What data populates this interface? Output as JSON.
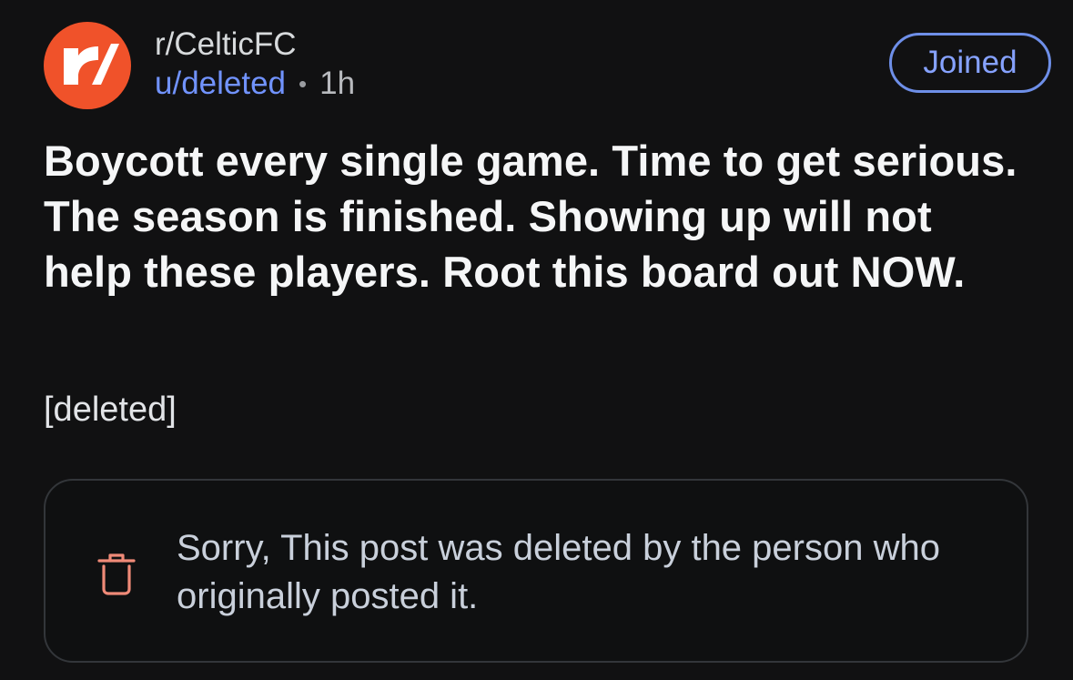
{
  "post": {
    "subreddit": "r/CelticFC",
    "author": "u/deleted",
    "separator": "•",
    "time": "1h",
    "join_button_label": "Joined",
    "title": "Boycott every single game. Time to get serious. The season is finished. Showing up will not help these players. Root this board out NOW.",
    "body": "[deleted]"
  },
  "notice": {
    "icon": "trash-icon",
    "text": "Sorry, This post was deleted by the person who originally posted it."
  },
  "colors": {
    "background": "#111112",
    "avatar": "#f0522a",
    "author": "#7193ff",
    "join_border": "#6e8fe8",
    "notice_icon": "#ef8a78"
  }
}
